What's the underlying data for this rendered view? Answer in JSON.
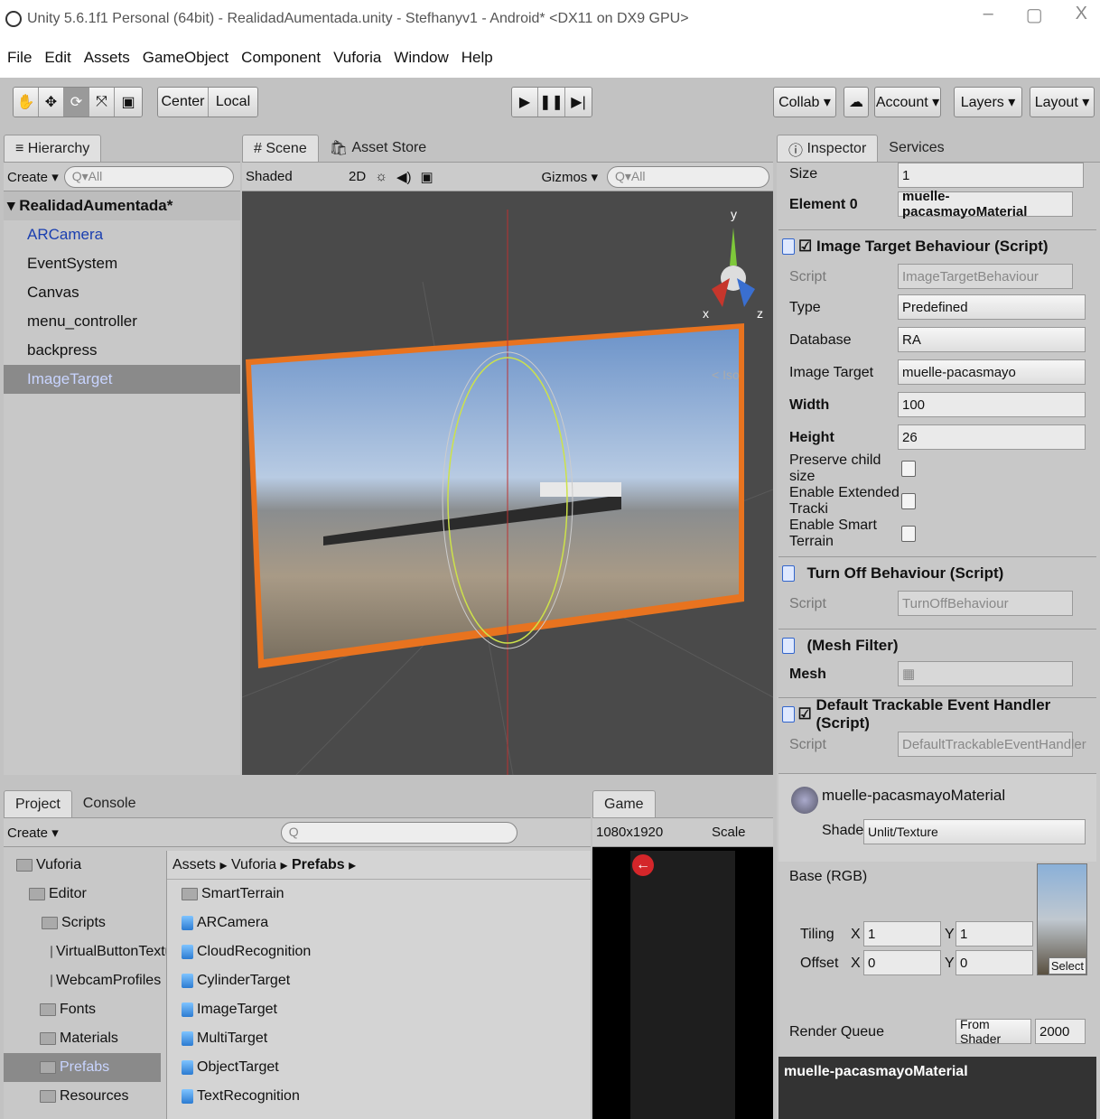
{
  "window": {
    "title": "Unity 5.6.1f1 Personal (64bit) - RealidadAumentada.unity - Stefhanyv1 - Android* <DX11 on DX9 GPU>",
    "minimize": "–",
    "restore": "▢",
    "close": "X"
  },
  "menu": [
    "File",
    "Edit",
    "Assets",
    "GameObject",
    "Component",
    "Vuforia",
    "Window",
    "Help"
  ],
  "toolbar": {
    "transform_tools": [
      "✋",
      "✥",
      "⟳",
      "⤧",
      "▣"
    ],
    "pivot": "Center",
    "space": "Local",
    "collab": "Collab ▾",
    "cloud": "☁",
    "account": "Account ▾",
    "layers": "Layers ▾",
    "layout": "Layout ▾"
  },
  "hierarchy": {
    "tab": "Hierarchy",
    "create": "Create ▾",
    "search_placeholder": "Q▾All",
    "scene": "RealidadAumentada*",
    "items": [
      "ARCamera",
      "EventSystem",
      "Canvas",
      "menu_controller",
      "backpress",
      "ImageTarget"
    ]
  },
  "scene": {
    "tabs": [
      "Scene",
      "Asset Store"
    ],
    "shading": "Shaded",
    "mode2d": "2D",
    "gizmos": "Gizmos ▾",
    "search_placeholder": "Q▾All",
    "axis_y": "y",
    "axis_x": "x",
    "axis_z": "z",
    "persp": "< Iso"
  },
  "inspector": {
    "tabs": [
      "Inspector",
      "Services"
    ],
    "size_label": "Size",
    "size_value": "1",
    "element0_label": "Element 0",
    "element0_value": "muelle-pacasmayoMaterial",
    "image_target": {
      "header": "Image Target Behaviour (Script)",
      "script_label": "Script",
      "script_value": "ImageTargetBehaviour",
      "type_label": "Type",
      "type_value": "Predefined",
      "database_label": "Database",
      "database_value": "RA",
      "image_target_label": "Image Target",
      "image_target_value": "muelle-pacasmayo",
      "width_label": "Width",
      "width_value": "100",
      "height_label": "Height",
      "height_value": "26",
      "preserve_label": "Preserve child size",
      "extended_label": "Enable Extended Tracki",
      "smart_label": "Enable Smart Terrain"
    },
    "turnoff": {
      "header": "Turn Off Behaviour (Script)",
      "script_label": "Script",
      "script_value": "TurnOffBehaviour"
    },
    "meshfilter": {
      "header": "(Mesh Filter)",
      "mesh_label": "Mesh",
      "mesh_value": "▦"
    },
    "dteh": {
      "header": "Default Trackable Event Handler (Script)",
      "script_label": "Script",
      "script_value": "DefaultTrackableEventHandler"
    },
    "material": {
      "name": "muelle-pacasmayoMaterial",
      "shader_label": "Shader",
      "shader_value": "Unlit/Texture",
      "base_label": "Base (RGB)",
      "tiling_label": "Tiling",
      "offset_label": "Offset",
      "x": "X",
      "y": "Y",
      "tiling_x": "1",
      "tiling_y": "1",
      "offset_x": "0",
      "offset_y": "0",
      "select": "Select",
      "render_queue_label": "Render Queue",
      "render_queue_mode": "From Shader",
      "render_queue_value": "2000"
    },
    "preview_title": "muelle-pacasmayoMaterial"
  },
  "project": {
    "tabs": [
      "Project",
      "Console"
    ],
    "create": "Create ▾",
    "search_placeholder": "Q",
    "tree": [
      "Vuforia",
      "Editor",
      "Scripts",
      "VirtualButtonTextur",
      "WebcamProfiles",
      "Fonts",
      "Materials",
      "Prefabs",
      "Resources"
    ],
    "breadcrumb": [
      "Assets",
      "Vuforia",
      "Prefabs"
    ],
    "items": [
      "SmartTerrain",
      "ARCamera",
      "CloudRecognition",
      "CylinderTarget",
      "ImageTarget",
      "MultiTarget",
      "ObjectTarget",
      "TextRecognition"
    ]
  },
  "game": {
    "tab": "Game",
    "resolution": "1080x1920",
    "scale": "Scale"
  }
}
